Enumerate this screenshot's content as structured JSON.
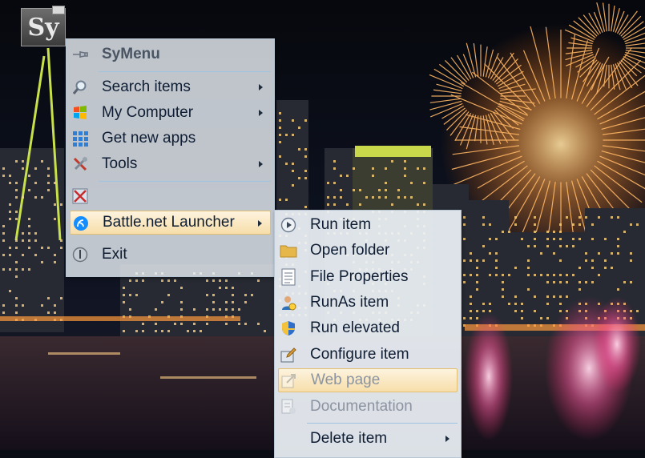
{
  "tray": {
    "logo_text": "Sy",
    "icon": "symenu-tray-icon"
  },
  "main_menu": {
    "title": "SyMenu",
    "items": [
      {
        "label": "Search items",
        "icon": "magnifier-icon",
        "submenu": true
      },
      {
        "label": "My Computer",
        "icon": "windows-flag-icon",
        "submenu": true
      },
      {
        "label": "Get new apps",
        "icon": "grid-icon",
        "submenu": false
      },
      {
        "label": "Tools",
        "icon": "tools-icon",
        "submenu": true
      },
      {
        "label": "",
        "icon": "no-entry-icon",
        "submenu": false
      },
      {
        "label": "Battle.net Launcher",
        "icon": "battlenet-icon",
        "submenu": true,
        "highlighted": true
      },
      {
        "label": "Exit",
        "icon": "power-icon",
        "submenu": false
      }
    ]
  },
  "sub_menu": {
    "items": [
      {
        "label": "Run item",
        "icon": "play-icon"
      },
      {
        "label": "Open folder",
        "icon": "folder-icon"
      },
      {
        "label": "File Properties",
        "icon": "properties-icon"
      },
      {
        "label": "RunAs item",
        "icon": "user-icon"
      },
      {
        "label": "Run elevated",
        "icon": "shield-icon"
      },
      {
        "label": "Configure item",
        "icon": "configure-icon"
      },
      {
        "label": "Web page",
        "icon": "web-icon",
        "highlighted": true,
        "disabled": true
      },
      {
        "label": "Documentation",
        "icon": "documentation-icon",
        "disabled": true
      },
      {
        "label": "Delete item",
        "icon": "delete-icon",
        "submenu": true
      }
    ]
  },
  "colors": {
    "menu_text": "#0e1d33",
    "disabled_text": "#8b94a0",
    "highlight": "#f7deaa",
    "separator": "#9ec4e2"
  }
}
